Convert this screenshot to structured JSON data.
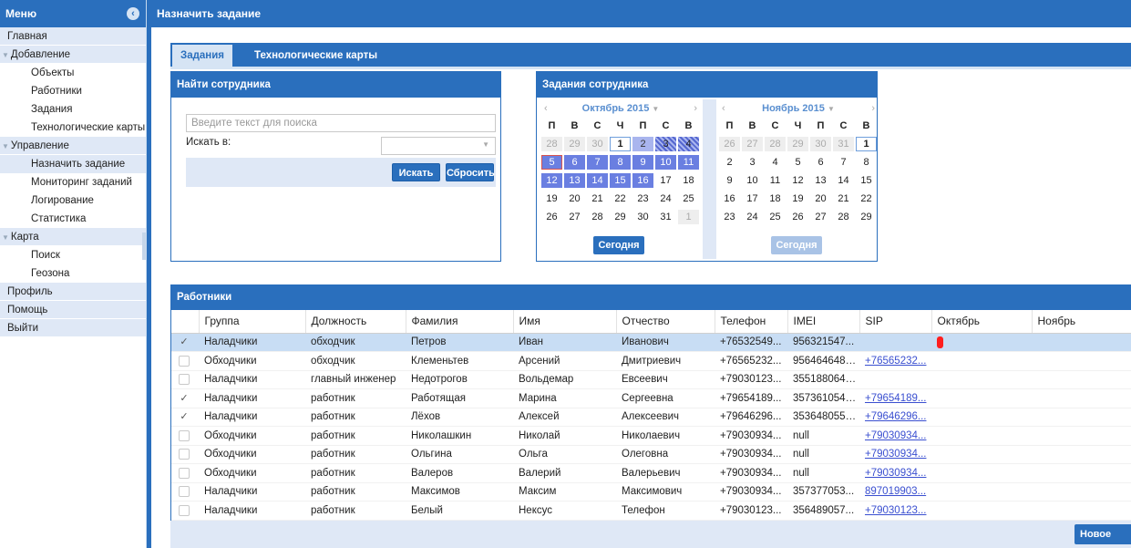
{
  "sidebar": {
    "title": "Меню",
    "collapse_icon": "chevron-left-circle-icon",
    "items": [
      {
        "label": "Главная",
        "type": "top"
      },
      {
        "label": "Добавление",
        "type": "group"
      },
      {
        "label": "Объекты",
        "type": "sub"
      },
      {
        "label": "Работники",
        "type": "sub"
      },
      {
        "label": "Задания",
        "type": "sub"
      },
      {
        "label": "Технологические карты",
        "type": "sub"
      },
      {
        "label": "Управление",
        "type": "group"
      },
      {
        "label": "Назначить задание",
        "type": "sub",
        "active": true
      },
      {
        "label": "Мониторинг заданий",
        "type": "sub"
      },
      {
        "label": "Логирование",
        "type": "sub"
      },
      {
        "label": "Статистика",
        "type": "sub"
      },
      {
        "label": "Карта",
        "type": "group"
      },
      {
        "label": "Поиск",
        "type": "sub"
      },
      {
        "label": "Геозона",
        "type": "sub"
      },
      {
        "label": "Профиль",
        "type": "top"
      },
      {
        "label": "Помощь",
        "type": "top"
      },
      {
        "label": "Выйти",
        "type": "top"
      }
    ]
  },
  "header": {
    "title": "Назначить задание"
  },
  "tabs": [
    {
      "label": "Задания",
      "active": true
    },
    {
      "label": "Технологические карты",
      "active": false
    }
  ],
  "find_panel": {
    "title": "Найти сотрудника",
    "search_placeholder": "Введите текст для поиска",
    "search_in_label": "Искать в:",
    "search_in_value": "",
    "find_button": "Искать",
    "reset_button": "Сбросить"
  },
  "calendar_panel": {
    "title": "Задания сотрудника",
    "dow": [
      "П",
      "В",
      "С",
      "Ч",
      "П",
      "С",
      "В"
    ],
    "calendars": [
      {
        "month_label": "Октябрь 2015",
        "today_button": "Сегодня",
        "today_enabled": true,
        "days": [
          [
            "28",
            "other"
          ],
          [
            "29",
            "other"
          ],
          [
            "30",
            "other"
          ],
          [
            "1",
            "today"
          ],
          [
            "2",
            "light"
          ],
          [
            "3",
            "hatch"
          ],
          [
            "4",
            "hatch"
          ],
          [
            "5",
            "task sel"
          ],
          [
            "6",
            "task"
          ],
          [
            "7",
            "task"
          ],
          [
            "8",
            "task"
          ],
          [
            "9",
            "task"
          ],
          [
            "10",
            "task"
          ],
          [
            "11",
            "task"
          ],
          [
            "12",
            "task"
          ],
          [
            "13",
            "task"
          ],
          [
            "14",
            "task"
          ],
          [
            "15",
            "task"
          ],
          [
            "16",
            "task"
          ],
          [
            "17",
            ""
          ],
          [
            "18",
            ""
          ],
          [
            "19",
            ""
          ],
          [
            "20",
            ""
          ],
          [
            "21",
            ""
          ],
          [
            "22",
            ""
          ],
          [
            "23",
            ""
          ],
          [
            "24",
            ""
          ],
          [
            "25",
            ""
          ],
          [
            "26",
            ""
          ],
          [
            "27",
            ""
          ],
          [
            "28",
            ""
          ],
          [
            "29",
            ""
          ],
          [
            "30",
            ""
          ],
          [
            "31",
            ""
          ],
          [
            "1",
            "other"
          ]
        ]
      },
      {
        "month_label": "Ноябрь 2015",
        "today_button": "Сегодня",
        "today_enabled": false,
        "days": [
          [
            "26",
            "other"
          ],
          [
            "27",
            "other"
          ],
          [
            "28",
            "other"
          ],
          [
            "29",
            "other"
          ],
          [
            "30",
            "other"
          ],
          [
            "31",
            "other"
          ],
          [
            "1",
            "today"
          ],
          [
            "2",
            ""
          ],
          [
            "3",
            ""
          ],
          [
            "4",
            ""
          ],
          [
            "5",
            ""
          ],
          [
            "6",
            ""
          ],
          [
            "7",
            ""
          ],
          [
            "8",
            ""
          ],
          [
            "9",
            ""
          ],
          [
            "10",
            ""
          ],
          [
            "11",
            ""
          ],
          [
            "12",
            ""
          ],
          [
            "13",
            ""
          ],
          [
            "14",
            ""
          ],
          [
            "15",
            ""
          ],
          [
            "16",
            ""
          ],
          [
            "17",
            ""
          ],
          [
            "18",
            ""
          ],
          [
            "19",
            ""
          ],
          [
            "20",
            ""
          ],
          [
            "21",
            ""
          ],
          [
            "22",
            ""
          ],
          [
            "23",
            ""
          ],
          [
            "24",
            ""
          ],
          [
            "25",
            ""
          ],
          [
            "26",
            ""
          ],
          [
            "27",
            ""
          ],
          [
            "28",
            ""
          ],
          [
            "29",
            ""
          ]
        ]
      }
    ]
  },
  "workers": {
    "title": "Работники",
    "columns": [
      "",
      "Группа",
      "Должность",
      "Фамилия",
      "Имя",
      "Отчество",
      "Телефон",
      "IMEI",
      "SIP",
      "Октябрь",
      "Ноябрь"
    ],
    "rows": [
      {
        "checked": true,
        "selected": true,
        "group": "Наладчики",
        "position": "обходчик",
        "last": "Петров",
        "first": "Иван",
        "middle": "Иванович",
        "phone": "+76532549...",
        "imei": "956321547...",
        "sip": "",
        "oct_mark": true
      },
      {
        "checked": false,
        "group": "Обходчики",
        "position": "обходчик",
        "last": "Клеменьтев",
        "first": "Арсений",
        "middle": "Дмитриевич",
        "phone": "+76565232...",
        "imei": "9564646481...",
        "sip": "+76565232..."
      },
      {
        "checked": false,
        "group": "Наладчики",
        "position": "главный инженер",
        "last": "Недотрогов",
        "first": "Вольдемар",
        "middle": "Евсеевич",
        "phone": "+79030123...",
        "imei": "3551880641...",
        "sip": ""
      },
      {
        "checked": true,
        "group": "Наладчики",
        "position": "работник",
        "last": "Работящая",
        "first": "Марина",
        "middle": "Сергеевна",
        "phone": "+79654189...",
        "imei": "3573610545...",
        "sip": "+79654189..."
      },
      {
        "checked": true,
        "group": "Наладчики",
        "position": "работник",
        "last": "Лёхов",
        "first": "Алексей",
        "middle": "Алексеевич",
        "phone": "+79646296...",
        "imei": "3536480553...",
        "sip": "+79646296..."
      },
      {
        "checked": false,
        "group": "Обходчики",
        "position": "работник",
        "last": "Николашкин",
        "first": "Николай",
        "middle": "Николаевич",
        "phone": "+79030934...",
        "imei": "null",
        "sip": "+79030934..."
      },
      {
        "checked": false,
        "group": "Обходчики",
        "position": "работник",
        "last": "Ольгина",
        "first": "Ольга",
        "middle": "Олеговна",
        "phone": "+79030934...",
        "imei": "null",
        "sip": "+79030934..."
      },
      {
        "checked": false,
        "group": "Обходчики",
        "position": "работник",
        "last": "Валеров",
        "first": "Валерий",
        "middle": "Валерьевич",
        "phone": "+79030934...",
        "imei": "null",
        "sip": "+79030934..."
      },
      {
        "checked": false,
        "group": "Наладчики",
        "position": "работник",
        "last": "Максимов",
        "first": "Максим",
        "middle": "Максимович",
        "phone": "+79030934...",
        "imei": "357377053...",
        "sip": "897019903..."
      },
      {
        "checked": false,
        "group": "Наладчики",
        "position": "работник",
        "last": "Белый",
        "first": "Нексус",
        "middle": "Телефон",
        "phone": "+79030123...",
        "imei": "356489057...",
        "sip": "+79030123..."
      }
    ]
  },
  "footer": {
    "new_task_button": "Новое задание"
  },
  "colors": {
    "brand": "#2a6fbd",
    "panel_light": "#dfe8f6",
    "task_day": "#6a7fe1",
    "sip_link": "#3a4fd0",
    "oct_mark": "#ff1e1e"
  }
}
